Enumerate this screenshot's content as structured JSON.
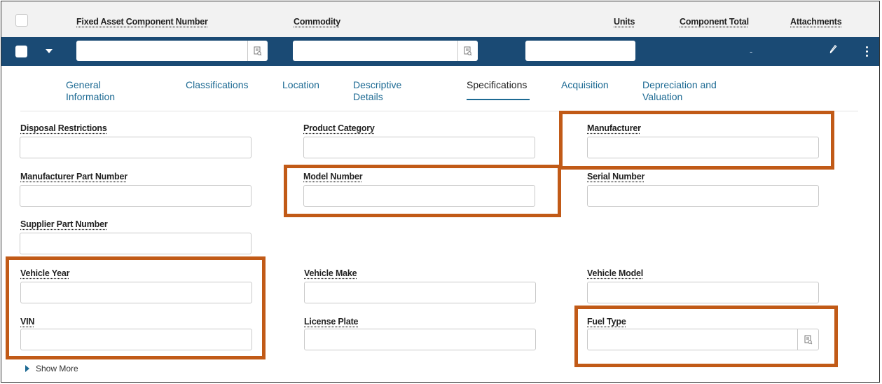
{
  "header": {
    "columns": {
      "component_number": "Fixed Asset Component Number",
      "commodity": "Commodity",
      "units": "Units",
      "component_total": "Component Total",
      "attachments": "Attachments"
    }
  },
  "row": {
    "component_number_value": "",
    "commodity_value": "",
    "units_value": "",
    "component_total": "-"
  },
  "tabs": [
    {
      "label": "General Information",
      "line1": "General",
      "line2": "Information"
    },
    {
      "label": "Classifications"
    },
    {
      "label": "Location"
    },
    {
      "label": "Descriptive Details",
      "line1": "Descriptive",
      "line2": "Details"
    },
    {
      "label": "Specifications",
      "active": true
    },
    {
      "label": "Acquisition"
    },
    {
      "label": "Depreciation and Valuation",
      "line1": "Depreciation and",
      "line2": "Valuation"
    }
  ],
  "fields": {
    "disposal_restrictions": {
      "label": "Disposal Restrictions",
      "value": ""
    },
    "product_category": {
      "label": "Product Category",
      "value": ""
    },
    "manufacturer": {
      "label": "Manufacturer",
      "value": ""
    },
    "manufacturer_part_number": {
      "label": "Manufacturer Part Number",
      "value": ""
    },
    "model_number": {
      "label": "Model Number",
      "value": ""
    },
    "serial_number": {
      "label": "Serial Number",
      "value": ""
    },
    "supplier_part_number": {
      "label": "Supplier Part Number",
      "value": ""
    },
    "vehicle_year": {
      "label": "Vehicle Year",
      "value": ""
    },
    "vehicle_make": {
      "label": "Vehicle Make",
      "value": ""
    },
    "vehicle_model": {
      "label": "Vehicle Model",
      "value": ""
    },
    "vin": {
      "label": "VIN",
      "value": ""
    },
    "license_plate": {
      "label": "License Plate",
      "value": ""
    },
    "fuel_type": {
      "label": "Fuel Type",
      "value": ""
    }
  },
  "show_more": "Show More",
  "icons": {
    "lookup": "lookup-icon",
    "pencil": "pencil-icon",
    "kebab": "more-vertical-icon",
    "caret": "caret-down-icon"
  },
  "colors": {
    "row_bar": "#1a4a74",
    "tab_link": "#1d6a93",
    "highlight": "#c15a17"
  }
}
